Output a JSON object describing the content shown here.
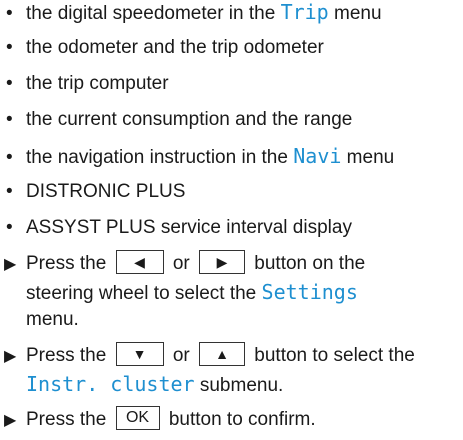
{
  "bullets": [
    {
      "pre": "the digital speedometer in the ",
      "key": "Trip",
      "post": " menu"
    },
    {
      "pre": "the odometer and the trip odometer"
    },
    {
      "pre": "the trip computer"
    },
    {
      "pre": "the current consumption and the range"
    },
    {
      "pre": "the navigation instruction in the ",
      "key": "Navi",
      "post": " menu"
    },
    {
      "pre": "DISTRONIC PLUS"
    },
    {
      "pre": "ASSYST PLUS service interval display"
    }
  ],
  "markers": {
    "bullet": "•",
    "arrow": "▶"
  },
  "steps": [
    {
      "line1_pre": "Press the ",
      "btn1_glyph": "◀",
      "line1_mid": " or ",
      "btn2_glyph": "▶",
      "line1_post": " button on the",
      "line2_pre": "steering wheel to select the ",
      "line2_key": "Settings",
      "line3": "menu."
    },
    {
      "line1_pre": "Press the ",
      "btn1_glyph": "▼",
      "line1_mid": " or ",
      "btn2_glyph": "▲",
      "line1_post": " button to select the",
      "line2_key": "Instr. cluster",
      "line2_post": " submenu."
    },
    {
      "line1_pre": "Press the ",
      "btn1_label": "OK",
      "line1_post": " button to confirm."
    }
  ]
}
